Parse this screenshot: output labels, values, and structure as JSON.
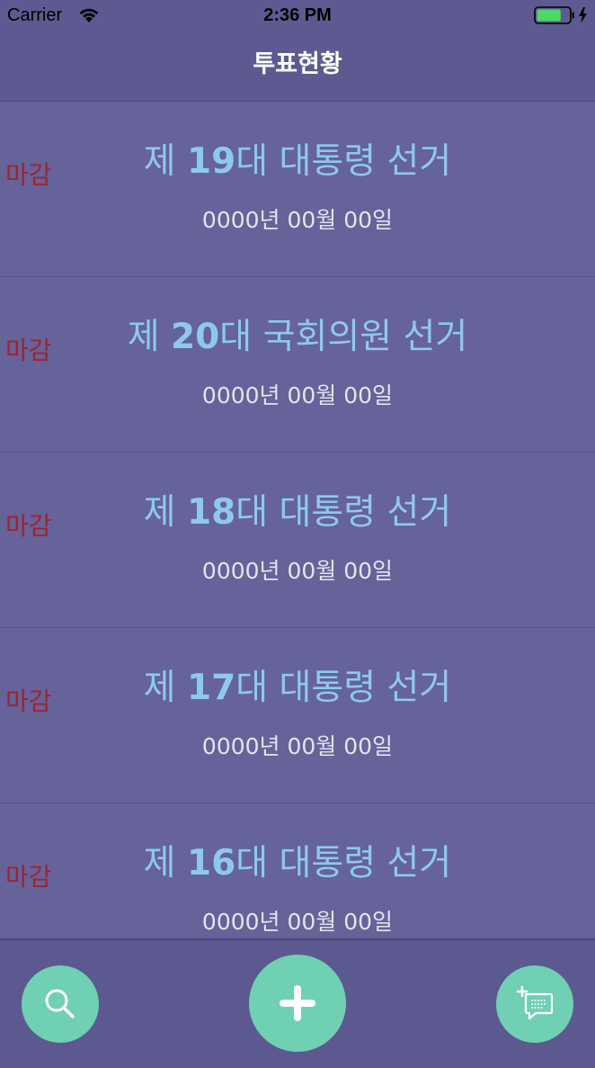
{
  "status_bar": {
    "carrier": "Carrier",
    "time": "2:36 PM",
    "battery_level": 0.75
  },
  "nav": {
    "title": "투표현황"
  },
  "elections": [
    {
      "status": "마감",
      "prefix": "제 ",
      "number": "19",
      "name": "대 대통령 선거",
      "date": "0000년 00월 00일"
    },
    {
      "status": "마감",
      "prefix": "제 ",
      "number": "20",
      "name": "대 국회의원 선거",
      "date": "0000년 00월 00일"
    },
    {
      "status": "마감",
      "prefix": "제 ",
      "number": "18",
      "name": "대 대통령 선거",
      "date": "0000년 00월 00일"
    },
    {
      "status": "마감",
      "prefix": "제 ",
      "number": "17",
      "name": "대 대통령 선거",
      "date": "0000년 00월 00일"
    },
    {
      "status": "마감",
      "prefix": "제 ",
      "number": "16",
      "name": "대 대통령 선거",
      "date": "0000년 00월 00일"
    }
  ],
  "toolbar": {
    "search_icon": "magnifier-icon",
    "add_icon": "plus-icon",
    "compose_icon": "add-comment-icon"
  },
  "colors": {
    "background": "#66629a",
    "accent_green": "#6fd0b3",
    "title_blue": "#8ec9ec",
    "closed_red": "#a0242e"
  }
}
